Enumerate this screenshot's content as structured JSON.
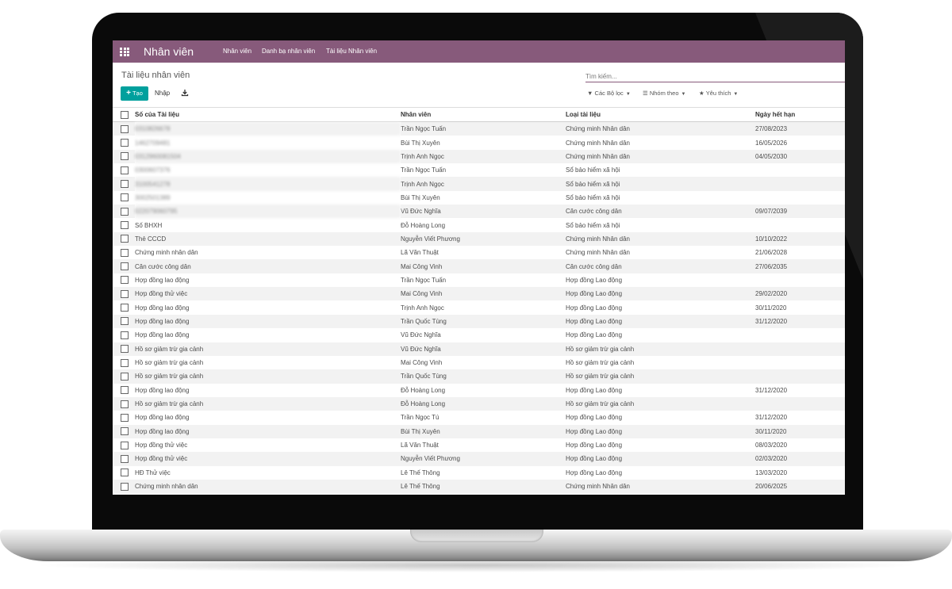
{
  "navbar": {
    "app_title": "Nhân viên",
    "menu": [
      "Nhân viên",
      "Danh bạ nhân viên",
      "Tài liệu Nhân viên"
    ],
    "background_color": "#875a7b"
  },
  "control": {
    "breadcrumb": "Tài liệu nhân viên",
    "create_button": "Tạo",
    "import_button": "Nhập",
    "search_placeholder": "Tìm kiếm...",
    "filters_label": "Các Bộ lọc",
    "group_by_label": "Nhóm theo",
    "favorites_label": "Yêu thích",
    "create_color": "#00a09d"
  },
  "table": {
    "columns": [
      "Số của Tài liệu",
      "Nhân viên",
      "Loại tài liệu",
      "Ngày hết hạn"
    ],
    "rows": [
      {
        "doc": "0310826678",
        "blurred": true,
        "employee": "Trần Ngọc Tuấn",
        "type": "Chứng minh Nhân dân",
        "expiry": "27/08/2023"
      },
      {
        "doc": "1462709481",
        "blurred": true,
        "employee": "Bùi Thị Xuyên",
        "type": "Chứng minh Nhân dân",
        "expiry": "16/05/2026"
      },
      {
        "doc": "0312960081504",
        "blurred": true,
        "employee": "Trịnh Anh Ngọc",
        "type": "Chứng minh Nhân dân",
        "expiry": "04/05/2030"
      },
      {
        "doc": "0300607376",
        "blurred": true,
        "employee": "Trần Ngọc Tuấn",
        "type": "Sổ bảo hiểm xã hội",
        "expiry": ""
      },
      {
        "doc": "3100541278",
        "blurred": true,
        "employee": "Trịnh Anh Ngọc",
        "type": "Sổ bảo hiểm xã hội",
        "expiry": ""
      },
      {
        "doc": "3002501389",
        "blurred": true,
        "employee": "Bùi Thị Xuyên",
        "type": "Sổ bảo hiểm xã hội",
        "expiry": ""
      },
      {
        "doc": "022079060795",
        "blurred": true,
        "employee": "Vũ Đức Nghĩa",
        "type": "Căn cước công dân",
        "expiry": "09/07/2039"
      },
      {
        "doc": "Số BHXH",
        "blurred": false,
        "employee": "Đỗ Hoàng Long",
        "type": "Sổ bảo hiểm xã hội",
        "expiry": ""
      },
      {
        "doc": "Thẻ CCCD",
        "blurred": false,
        "employee": "Nguyễn Viết Phương",
        "type": "Chứng minh Nhân dân",
        "expiry": "10/10/2022"
      },
      {
        "doc": "Chứng minh nhân dân",
        "blurred": false,
        "employee": "Lã Văn Thuật",
        "type": "Chứng minh Nhân dân",
        "expiry": "21/06/2028"
      },
      {
        "doc": "Căn cước công dân",
        "blurred": false,
        "employee": "Mai Công Vinh",
        "type": "Căn cước công dân",
        "expiry": "27/06/2035"
      },
      {
        "doc": "Hợp đồng lao động",
        "blurred": false,
        "employee": "Trần Ngọc Tuấn",
        "type": "Hợp đồng Lao động",
        "expiry": ""
      },
      {
        "doc": "Hợp đồng thử việc",
        "blurred": false,
        "employee": "Mai Công Vinh",
        "type": "Hợp đồng Lao động",
        "expiry": "29/02/2020"
      },
      {
        "doc": "Hợp đồng lao động",
        "blurred": false,
        "employee": "Trịnh Anh Ngọc",
        "type": "Hợp đồng Lao động",
        "expiry": "30/11/2020"
      },
      {
        "doc": "Hợp đồng lao động",
        "blurred": false,
        "employee": "Trần Quốc Tùng",
        "type": "Hợp đồng Lao động",
        "expiry": "31/12/2020"
      },
      {
        "doc": "Hợp đồng lao động",
        "blurred": false,
        "employee": "Vũ Đức Nghĩa",
        "type": "Hợp đồng Lao động",
        "expiry": ""
      },
      {
        "doc": "Hồ sơ giảm trừ gia cảnh",
        "blurred": false,
        "employee": "Vũ Đức Nghĩa",
        "type": "Hồ sơ giảm trừ gia cảnh",
        "expiry": ""
      },
      {
        "doc": "Hồ sơ giảm trừ gia cảnh",
        "blurred": false,
        "employee": "Mai Công Vinh",
        "type": "Hồ sơ giảm trừ gia cảnh",
        "expiry": ""
      },
      {
        "doc": "Hồ sơ giảm trừ gia cảnh",
        "blurred": false,
        "employee": "Trần Quốc Tùng",
        "type": "Hồ sơ giảm trừ gia cảnh",
        "expiry": ""
      },
      {
        "doc": "Hợp đồng lao động",
        "blurred": false,
        "employee": "Đỗ Hoàng Long",
        "type": "Hợp đồng Lao động",
        "expiry": "31/12/2020"
      },
      {
        "doc": "Hồ sơ giảm trừ gia cảnh",
        "blurred": false,
        "employee": "Đỗ Hoàng Long",
        "type": "Hồ sơ giảm trừ gia cảnh",
        "expiry": ""
      },
      {
        "doc": "Hợp đồng lao động",
        "blurred": false,
        "employee": "Trần Ngọc Tú",
        "type": "Hợp đồng Lao động",
        "expiry": "31/12/2020"
      },
      {
        "doc": "Hợp đồng lao động",
        "blurred": false,
        "employee": "Bùi Thị Xuyên",
        "type": "Hợp đồng Lao động",
        "expiry": "30/11/2020"
      },
      {
        "doc": "Hợp đồng thử việc",
        "blurred": false,
        "employee": "Lã Văn Thuật",
        "type": "Hợp đồng Lao động",
        "expiry": "08/03/2020"
      },
      {
        "doc": "Hợp đồng thử việc",
        "blurred": false,
        "employee": "Nguyễn Viết Phương",
        "type": "Hợp đồng Lao động",
        "expiry": "02/03/2020"
      },
      {
        "doc": "HĐ Thử việc",
        "blurred": false,
        "employee": "Lê Thế Thông",
        "type": "Hợp đồng Lao động",
        "expiry": "13/03/2020"
      },
      {
        "doc": "Chứng minh nhân dân",
        "blurred": false,
        "employee": "Lê Thế Thông",
        "type": "Chứng minh Nhân dân",
        "expiry": "20/06/2025"
      }
    ]
  }
}
